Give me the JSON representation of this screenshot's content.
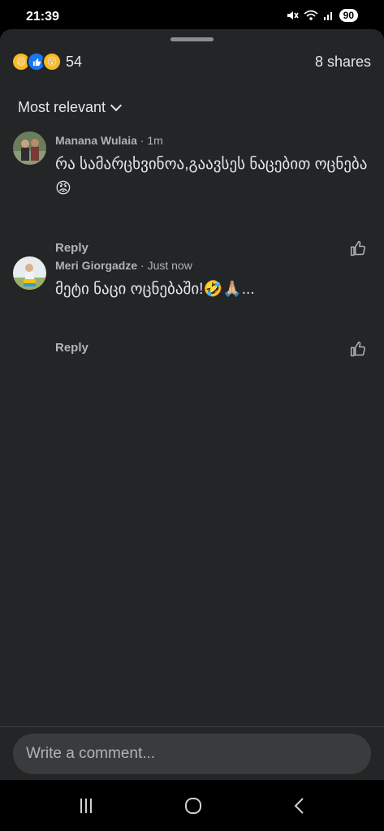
{
  "status": {
    "time": "21:39",
    "battery": "90"
  },
  "header": {
    "reaction_count": "54",
    "shares": "8 shares"
  },
  "sort": {
    "label": "Most relevant"
  },
  "comments": [
    {
      "author": "Manana Wulaia",
      "time": "· 1m",
      "text": "რა სამარცხვინოა,გაავსეს ნაცებით ოცნება😡",
      "reply": "Reply"
    },
    {
      "author": "Meri Giorgadze",
      "time": "· Just now",
      "text": "მეტი ნაცი ოცნებაში!🤣🙏🏼...",
      "reply": "Reply"
    }
  ],
  "composer": {
    "placeholder": "Write a comment..."
  },
  "icons": {
    "reactions": [
      "haha-reaction-icon",
      "like-reaction-icon",
      "wow-reaction-icon"
    ],
    "nav": [
      "recents-icon",
      "home-icon",
      "back-icon"
    ]
  }
}
